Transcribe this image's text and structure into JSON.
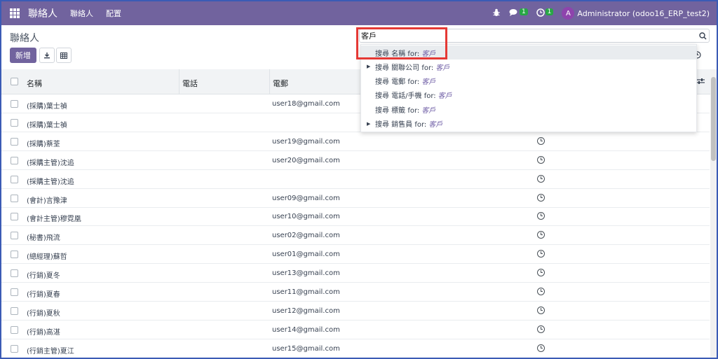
{
  "navbar": {
    "brand": "聯絡人",
    "menu": [
      "聯絡人",
      "配置"
    ],
    "messages_count": "1",
    "activities_count": "1",
    "avatar_letter": "A",
    "user": "Administrator (odoo16_ERP_test2)"
  },
  "control_panel": {
    "breadcrumb": "聯絡人",
    "new_button": "新增"
  },
  "search": {
    "value": "客戶",
    "suggestions": [
      {
        "label": "搜尋 名稱 for:",
        "query": "客戶",
        "expandable": false,
        "active": true
      },
      {
        "label": "搜尋 關聯公司 for:",
        "query": "客戶",
        "expandable": true,
        "active": false
      },
      {
        "label": "搜尋 電郵 for:",
        "query": "客戶",
        "expandable": false,
        "active": false
      },
      {
        "label": "搜尋 電話/手機 for:",
        "query": "客戶",
        "expandable": false,
        "active": false
      },
      {
        "label": "搜尋 標籤 for:",
        "query": "客戶",
        "expandable": false,
        "active": false
      },
      {
        "label": "搜尋 銷售員 for:",
        "query": "客戶",
        "expandable": true,
        "active": false
      }
    ]
  },
  "list": {
    "columns": {
      "name": "名稱",
      "phone": "電話",
      "email": "電郵"
    },
    "rows": [
      {
        "name": "(採購)葉士禎",
        "phone": "",
        "email": "user18@gmail.com",
        "activity": true
      },
      {
        "name": "(採購)葉士禎",
        "phone": "",
        "email": "",
        "activity": true
      },
      {
        "name": "(採購)蔡荃",
        "phone": "",
        "email": "user19@gmail.com",
        "activity": true
      },
      {
        "name": "(採購主管)沈追",
        "phone": "",
        "email": "user20@gmail.com",
        "activity": true
      },
      {
        "name": "(採購主管)沈追",
        "phone": "",
        "email": "",
        "activity": true
      },
      {
        "name": "(會計)言豫津",
        "phone": "",
        "email": "user09@gmail.com",
        "activity": true
      },
      {
        "name": "(會計主管)穆霓凰",
        "phone": "",
        "email": "user10@gmail.com",
        "activity": true
      },
      {
        "name": "(秘書)飛流",
        "phone": "",
        "email": "user02@gmail.com",
        "activity": true
      },
      {
        "name": "(總經理)蘇哲",
        "phone": "",
        "email": "user01@gmail.com",
        "activity": true
      },
      {
        "name": "(行銷)夏冬",
        "phone": "",
        "email": "user13@gmail.com",
        "activity": true
      },
      {
        "name": "(行銷)夏春",
        "phone": "",
        "email": "user11@gmail.com",
        "activity": true
      },
      {
        "name": "(行銷)夏秋",
        "phone": "",
        "email": "user12@gmail.com",
        "activity": true
      },
      {
        "name": "(行銷)高湛",
        "phone": "",
        "email": "user14@gmail.com",
        "activity": true
      },
      {
        "name": "(行銷主管)夏江",
        "phone": "",
        "email": "user15@gmail.com",
        "activity": true
      }
    ]
  }
}
